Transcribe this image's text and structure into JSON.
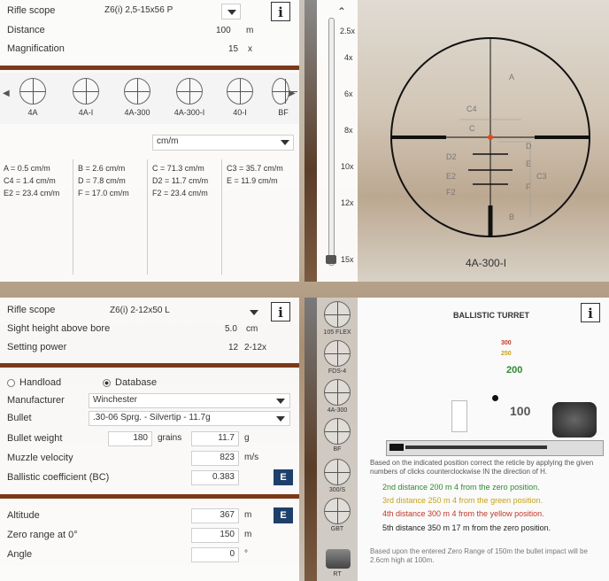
{
  "top": {
    "rifle_scope_label": "Rifle scope",
    "rifle_scope_value": "Z6(i) 2,5-15x56 P",
    "distance_label": "Distance",
    "distance_value": "100",
    "distance_unit": "m",
    "magnification_label": "Magnification",
    "magnification_value": "15",
    "magnification_unit": "x",
    "reticles": [
      "4A",
      "4A-I",
      "4A-300",
      "4A-300-I",
      "40-I",
      "BF"
    ],
    "unit_select": "cm/m",
    "measurements": [
      [
        "A = 0.5 cm/m",
        "C4 = 1.4 cm/m",
        "E2 = 23.4 cm/m"
      ],
      [
        "B = 2.6 cm/m",
        "D = 7.8 cm/m",
        "F = 17.0 cm/m"
      ],
      [
        "C = 71.3 cm/m",
        "D2 = 11.7 cm/m",
        "F2 = 23.4 cm/m"
      ],
      [
        "C3 = 35.7 cm/m",
        "E = 11.9 cm/m"
      ]
    ],
    "mag_scale": [
      "2.5x",
      "4x",
      "6x",
      "8x",
      "10x",
      "12x",
      "15x"
    ],
    "reticle_name": "4A-300-I",
    "reticle_labels": [
      "A",
      "C4",
      "C",
      "D",
      "D2",
      "E",
      "E2",
      "F",
      "F2",
      "C3",
      "B"
    ]
  },
  "bottom": {
    "rifle_scope_label": "Rifle scope",
    "rifle_scope_value": "Z6(i) 2-12x50 L",
    "sight_height_label": "Sight height above bore",
    "sight_height_value": "5.0",
    "sight_height_unit": "cm",
    "setting_power_label": "Setting power",
    "setting_power_value": "12",
    "setting_power_range": "2-12x",
    "handload_label": "Handload",
    "database_label": "Database",
    "manufacturer_label": "Manufacturer",
    "manufacturer_value": "Winchester",
    "bullet_label": "Bullet",
    "bullet_value": ".30-06 Sprg. - Silvertip - 11.7g",
    "bullet_weight_label": "Bullet weight",
    "bullet_weight_grains": "180",
    "grains_label": "grains",
    "bullet_weight_g": "11.7",
    "g_label": "g",
    "muzzle_velocity_label": "Muzzle velocity",
    "muzzle_velocity_value": "823",
    "muzzle_velocity_unit": "m/s",
    "bc_label": "Ballistic coefficient (BC)",
    "bc_value": "0.383",
    "altitude_label": "Altitude",
    "altitude_value": "367",
    "altitude_unit": "m",
    "zero_range_label": "Zero range at 0°",
    "zero_range_value": "150",
    "zero_range_unit": "m",
    "angle_label": "Angle",
    "angle_value": "0",
    "angle_unit": "°",
    "e_button": "E",
    "reticle_list": [
      "105 FLEX",
      "FDS-4",
      "4A-300",
      "BF",
      "300/S",
      "GBT",
      "RT"
    ]
  },
  "turret": {
    "title": "BALLISTIC TURRET",
    "marks": [
      "300",
      "250",
      "200",
      "100"
    ],
    "description": "Based on the indicated position correct the reticle by applying the given numbers of clicks counterclockwise IN the direction of H.",
    "distances": [
      {
        "text": "2nd distance  200 m  4 from the zero position.",
        "color": "#2f8a2f"
      },
      {
        "text": "3rd distance  250 m  4 from the green position.",
        "color": "#c9a21a"
      },
      {
        "text": "4th distance  300 m  4 from the yellow position.",
        "color": "#c0392b"
      },
      {
        "text": "5th distance  350 m  17 m from the zero position.",
        "color": "#222"
      }
    ],
    "footer": "Based upon the entered Zero Range of 150m the bullet impact will be 2.6cm high at 100m."
  },
  "colors": {
    "accent_bar": "#7a3a18",
    "e_button": "#1e3f6a"
  },
  "icons": [
    "chevron-down-icon",
    "info-icon",
    "chevron-left-icon",
    "chevron-right-icon",
    "chevron-up-icon",
    "reticle-icon",
    "turret-icon"
  ]
}
